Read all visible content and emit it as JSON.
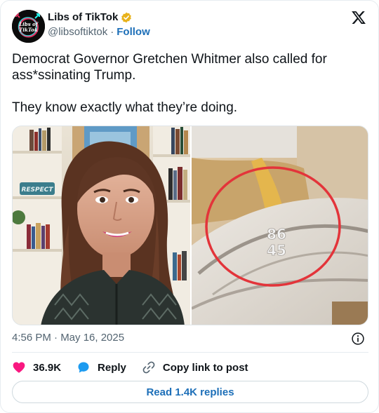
{
  "account": {
    "display_name": "Libs of TikTok",
    "handle": "@libsoftiktok",
    "separator": "·",
    "follow_label": "Follow",
    "verified_badge_color": "#e8b21b",
    "avatar_text_line1": "Libs of",
    "avatar_text_line2": "TikTok"
  },
  "tweet": {
    "paragraphs": [
      "Democrat Governor Gretchen Whitmer also called for ass*ssinating Trump.",
      "They know exactly what they’re doing."
    ],
    "timestamp": "4:56 PM · May 16, 2025"
  },
  "media": {
    "left_image": "video-still-woman-speaking-bookshelf",
    "left_sign_text": "RESPECT",
    "right_image": "zoomed-sand-marking-red-circle",
    "right_numbers": [
      "86",
      "45"
    ],
    "highlight_color": "#e3343a"
  },
  "actions": {
    "likes": "36.9K",
    "reply_label": "Reply",
    "copy_label": "Copy link to post"
  },
  "replies_button": "Read 1.4K replies",
  "colors": {
    "link_blue": "#1d6fb8",
    "like_pink": "#f91880",
    "reply_blue": "#1d9bf0",
    "muted_text": "#536471"
  }
}
